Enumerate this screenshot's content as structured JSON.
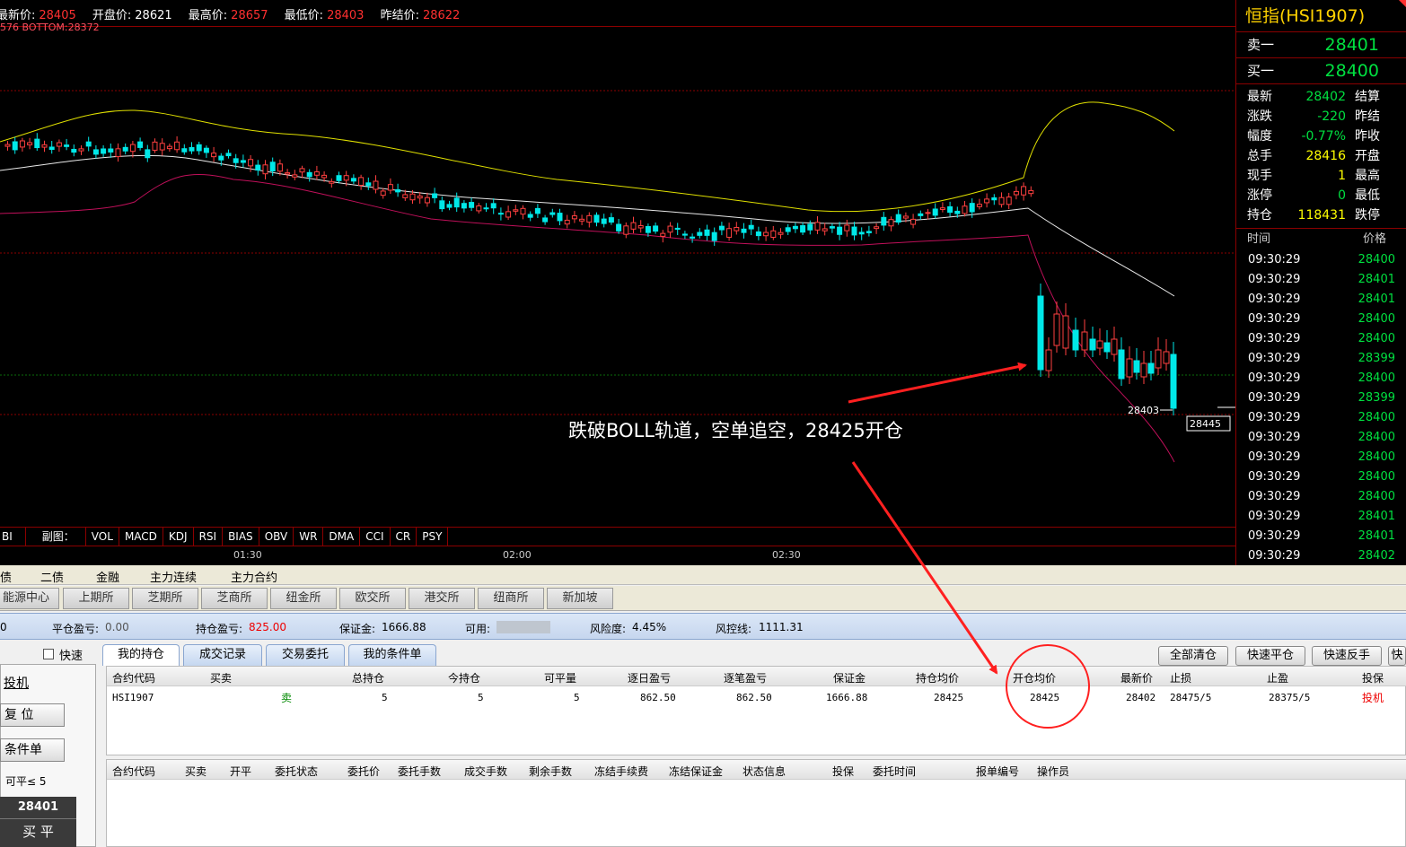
{
  "topbar": {
    "latest_label": "最新价:",
    "latest": "28405",
    "open_label": "开盘价:",
    "open": "28621",
    "high_label": "最高价:",
    "high": "28657",
    "low_label": "最低价:",
    "low": "28403",
    "prev_label": "昨结价:",
    "prev": "28622",
    "boll_text": "576  BOTTOM:28372"
  },
  "chart": {
    "last_price_label": "28403",
    "right_price_box": "28445",
    "annotation": "跌破BOLL轨道，空单追空，28425开仓"
  },
  "indicator_tabs": [
    "BI",
    "副图：",
    "VOL",
    "MACD",
    "KDJ",
    "RSI",
    "BIAS",
    "OBV",
    "WR",
    "DMA",
    "CCI",
    "CR",
    "PSY"
  ],
  "time_axis": [
    "01:30",
    "02:00",
    "02:30"
  ],
  "right_panel": {
    "title": "恒指(HSI1907)",
    "sell1_label": "卖一",
    "sell1": "28401",
    "buy1_label": "买一",
    "buy1": "28400",
    "stats": [
      {
        "label": "最新",
        "value": "28402",
        "label2": "结算"
      },
      {
        "label": "涨跌",
        "value": "-220",
        "label2": "昨结"
      },
      {
        "label": "幅度",
        "value": "-0.77%",
        "label2": "昨收"
      },
      {
        "label": "总手",
        "value": "28416",
        "label2": "开盘"
      },
      {
        "label": "现手",
        "value": "1",
        "label2": "最高"
      },
      {
        "label": "涨停",
        "value": "0",
        "label2": "最低"
      },
      {
        "label": "持仓",
        "value": "118431",
        "label2": "跌停"
      }
    ],
    "tick_header_time": "时间",
    "tick_header_price": "价格",
    "ticks": [
      {
        "t": "09:30:29",
        "p": "28400"
      },
      {
        "t": "09:30:29",
        "p": "28401"
      },
      {
        "t": "09:30:29",
        "p": "28401"
      },
      {
        "t": "09:30:29",
        "p": "28400"
      },
      {
        "t": "09:30:29",
        "p": "28400"
      },
      {
        "t": "09:30:29",
        "p": "28399"
      },
      {
        "t": "09:30:29",
        "p": "28400"
      },
      {
        "t": "09:30:29",
        "p": "28399"
      },
      {
        "t": "09:30:29",
        "p": "28400"
      },
      {
        "t": "09:30:29",
        "p": "28400"
      },
      {
        "t": "09:30:29",
        "p": "28400"
      },
      {
        "t": "09:30:29",
        "p": "28400"
      },
      {
        "t": "09:30:29",
        "p": "28400"
      },
      {
        "t": "09:30:29",
        "p": "28401"
      },
      {
        "t": "09:30:29",
        "p": "28401"
      },
      {
        "t": "09:30:29",
        "p": "28402"
      }
    ]
  },
  "categories": [
    "债",
    "二债",
    "金融",
    "主力连续",
    "主力合约"
  ],
  "exchanges": [
    "能源中心",
    "上期所",
    "芝期所",
    "芝商所",
    "纽金所",
    "欧交所",
    "港交所",
    "纽商所",
    "新加坡"
  ],
  "account": {
    "first": "0",
    "close_pl_label": "平仓盈亏:",
    "close_pl": "0.00",
    "pos_pl_label": "持仓盈亏:",
    "pos_pl": "825.00",
    "margin_label": "保证金:",
    "margin": "1666.88",
    "avail_label": "可用:",
    "risk_label": "风险度:",
    "risk": "4.45%",
    "riskline_label": "风控线:",
    "riskline": "1111.31"
  },
  "left_pane": {
    "fast_label": "快速",
    "spec_label": "投机",
    "reset_label": "复 位",
    "cond_label": "条件单",
    "closable_label": "可平≤ 5",
    "price": "28401",
    "action": "买 平"
  },
  "position_tabs": [
    "我的持仓",
    "成交记录",
    "交易委托",
    "我的条件单"
  ],
  "right_buttons": [
    "全部清仓",
    "快速平仓",
    "快速反手",
    "快"
  ],
  "position_table": {
    "headers": [
      "合约代码",
      "买卖",
      "总持仓",
      "今持仓",
      "可平量",
      "逐日盈亏",
      "逐笔盈亏",
      "保证金",
      "持仓均价",
      "开仓均价",
      "最新价",
      "止损",
      "止盈",
      "投保"
    ],
    "row": [
      "HSI1907",
      "卖",
      "5",
      "5",
      "5",
      "862.50",
      "862.50",
      "1666.88",
      "28425",
      "28425",
      "28402",
      "28475/5",
      "28375/5",
      "投机"
    ]
  },
  "order_table": {
    "headers": [
      "合约代码",
      "买卖",
      "开平",
      "委托状态",
      "委托价",
      "委托手数",
      "成交手数",
      "剩余手数",
      "冻结手续费",
      "冻结保证金",
      "状态信息",
      "投保",
      "委托时间",
      "报单编号",
      "操作员"
    ]
  },
  "chart_data": {
    "type": "candlestick",
    "series": [
      {
        "name": "BOTTOM",
        "values": [
          28372
        ]
      }
    ],
    "last_price": 28403
  }
}
